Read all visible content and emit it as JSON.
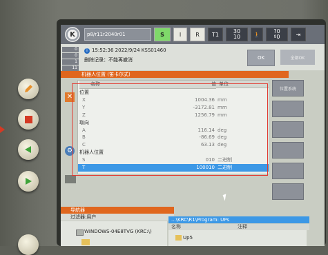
{
  "statusbar": {
    "program": "p8/r11r2040r01",
    "s_label": "S",
    "i_label": "I",
    "r_label": "R",
    "t1_label": "T1",
    "override_top": "30",
    "override_bottom": "10",
    "jog_top": "?0",
    "jog_bottom": "º0"
  },
  "messages": {
    "counters": [
      "0",
      "0",
      "1",
      "11"
    ],
    "line1": "15:52:36 2022/9/24 KSS01460",
    "line2": "删除记录：不能再撤消",
    "ok_label": "OK",
    "confirm_label": "全部OK"
  },
  "window_title": "机器人位置 (笛卡尔式)",
  "table": {
    "headers": {
      "name": "名称",
      "value": "值",
      "unit": "单位"
    },
    "rows": [
      {
        "name": "位置",
        "value": "",
        "unit": "",
        "kind": "grp"
      },
      {
        "name": "X",
        "value": "1004.36",
        "unit": "mm",
        "kind": "sub"
      },
      {
        "name": "Y",
        "value": "-3172.81",
        "unit": "mm",
        "kind": "sub"
      },
      {
        "name": "Z",
        "value": "1256.79",
        "unit": "mm",
        "kind": "sub"
      },
      {
        "name": "取向",
        "value": "",
        "unit": "",
        "kind": "grp"
      },
      {
        "name": "A",
        "value": "116.14",
        "unit": "deg",
        "kind": "sub"
      },
      {
        "name": "B",
        "value": "-86.69",
        "unit": "deg",
        "kind": "sub"
      },
      {
        "name": "C",
        "value": "63.13",
        "unit": "deg",
        "kind": "sub"
      },
      {
        "name": "机器人位置",
        "value": "",
        "unit": "",
        "kind": "grp"
      },
      {
        "name": "S",
        "value": "010",
        "unit": "二进制",
        "kind": "sub"
      },
      {
        "name": "T",
        "value": "100010",
        "unit": "二进制",
        "kind": "sel"
      }
    ]
  },
  "softkeys": [
    "位置系统"
  ],
  "navigator": {
    "title": "导航器",
    "filter": "过滤器:用户",
    "tree_item": "WINDOWS-04E8TVG (KRC:\\)",
    "path": "...\\KRC\\R1\\Program: UPs",
    "col_name": "名称",
    "col_comment": "注释",
    "item": "Up5"
  },
  "colors": {
    "accent": "#e0661e",
    "selection": "#3c98e6",
    "annotation": "#e23a32"
  }
}
